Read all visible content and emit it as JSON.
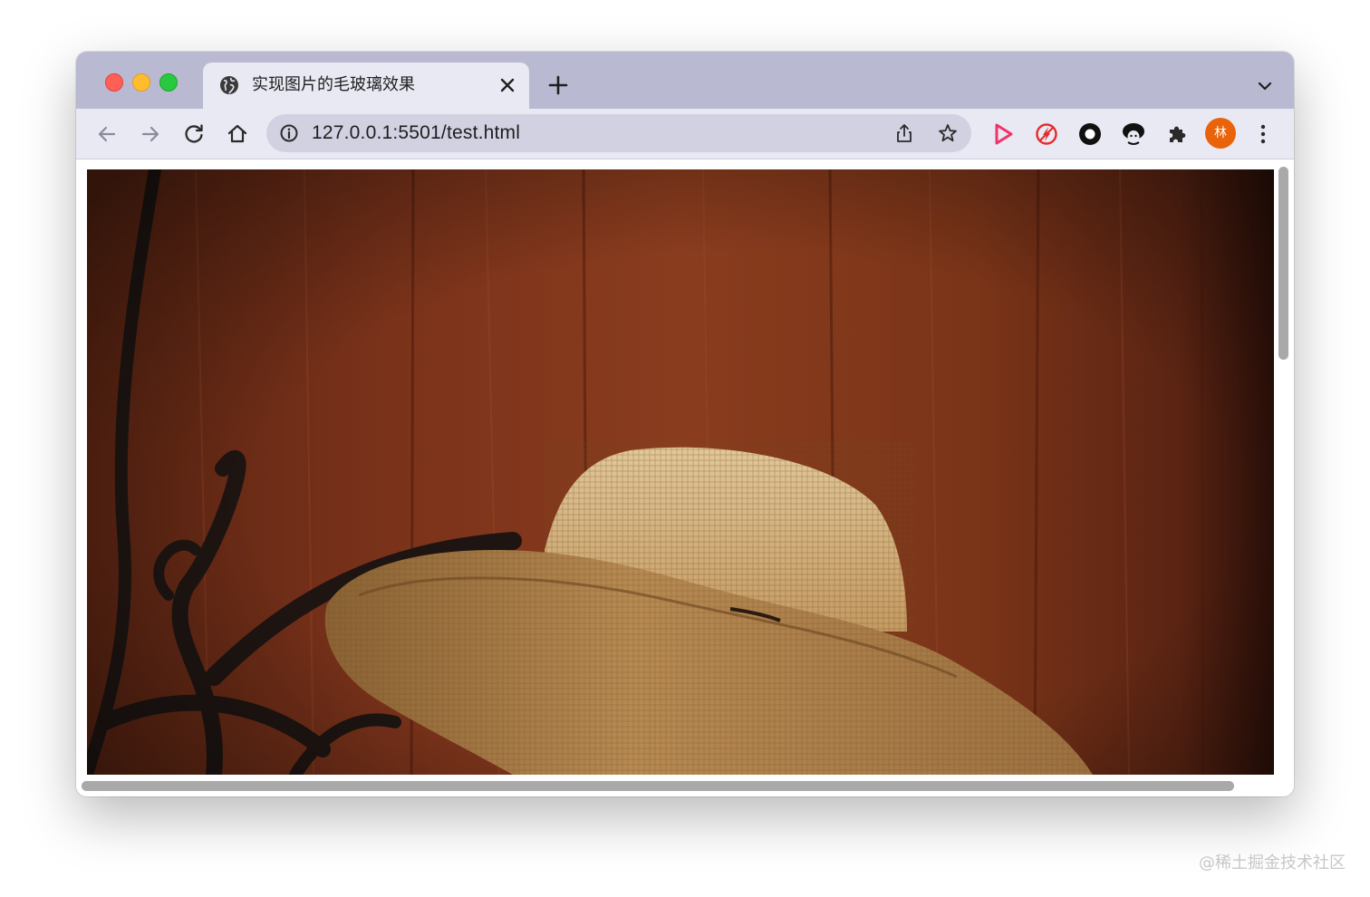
{
  "window_controls": {
    "close_color": "#fe5f57",
    "minimize_color": "#febc2e",
    "zoom_color": "#28c840"
  },
  "tab": {
    "title": "实现图片的毛玻璃效果",
    "favicon": "globe-icon"
  },
  "toolbar": {
    "url": "127.0.0.1:5501/test.html",
    "icons": [
      "back-arrow-icon",
      "forward-arrow-icon",
      "reload-icon",
      "home-icon",
      "info-icon",
      "share-icon",
      "star-icon"
    ],
    "extensions": [
      "play-extension-icon",
      "flash-blocker-extension-icon",
      "ring-extension-icon",
      "face-extension-icon",
      "puzzle-icon"
    ],
    "avatar_text": "林",
    "avatar_color": "#e8630a"
  },
  "page": {
    "image_subject": "woman-in-straw-hat-photo"
  },
  "watermark": "@稀土掘金技术社区"
}
